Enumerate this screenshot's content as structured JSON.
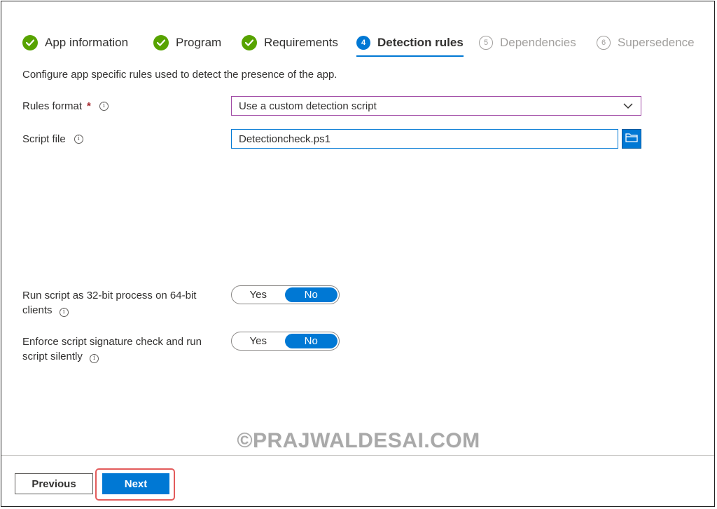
{
  "steps": [
    {
      "label": "App information",
      "state": "done"
    },
    {
      "label": "Program",
      "state": "done"
    },
    {
      "label": "Requirements",
      "state": "done"
    },
    {
      "number": "4",
      "label": "Detection rules",
      "state": "active"
    },
    {
      "number": "5",
      "label": "Dependencies",
      "state": "pending"
    },
    {
      "number": "6",
      "label": "Supersedence",
      "state": "pending"
    }
  ],
  "description": "Configure app specific rules used to detect the presence of the app.",
  "rules_format": {
    "label": "Rules format",
    "required_marker": "*",
    "value": "Use a custom detection script"
  },
  "script_file": {
    "label": "Script file",
    "value": "Detectioncheck.ps1"
  },
  "run_32bit": {
    "label": "Run script as 32-bit process on 64-bit clients",
    "yes": "Yes",
    "no": "No",
    "selected": "No"
  },
  "enforce_signature": {
    "label": "Enforce script signature check and run script silently",
    "yes": "Yes",
    "no": "No",
    "selected": "No"
  },
  "watermark": "©PRAJWALDESAI.COM",
  "footer": {
    "previous_label": "Previous",
    "next_label": "Next"
  },
  "colors": {
    "accent": "#0078d4",
    "success": "#57a300",
    "highlight": "#e35b5b"
  }
}
